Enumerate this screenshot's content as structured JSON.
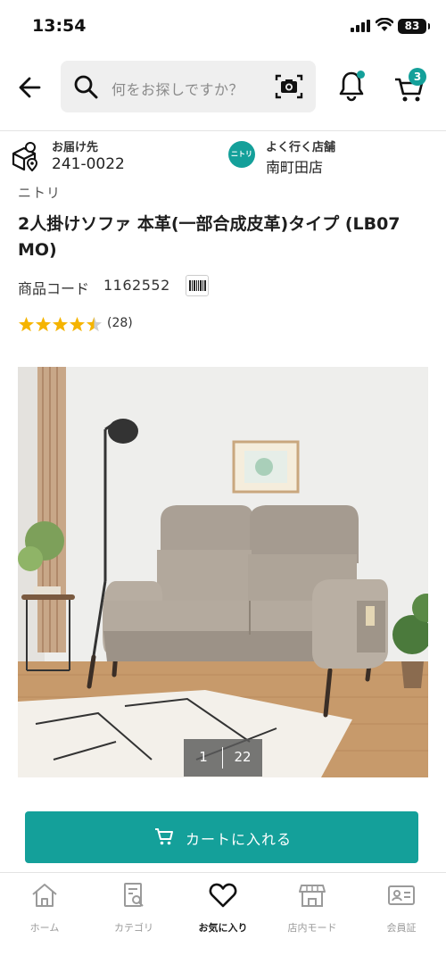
{
  "status_bar": {
    "time": "13:54",
    "battery": "83"
  },
  "header": {
    "search_placeholder": "何をお探しですか？",
    "notification_dot": true,
    "cart_count": "3"
  },
  "delivery": {
    "label": "お届け先",
    "postal_code": "241-0022"
  },
  "store": {
    "logo_text": "ニトリ",
    "label": "よく行く店舗",
    "name": "南町田店"
  },
  "product": {
    "brand": "ニトリ",
    "title": "2人掛けソファ 本革(一部合成皮革)タイプ (LB07 MO)",
    "code_label": "商品コード",
    "code": "1162552",
    "rating": 4.5,
    "review_count": "(28)"
  },
  "gallery": {
    "current": "1",
    "total": "22"
  },
  "actions": {
    "add_to_cart": "カートに入れる"
  },
  "bottom_nav": [
    {
      "label": "ホーム",
      "icon": "home-icon",
      "active": false
    },
    {
      "label": "カテゴリ",
      "icon": "category-icon",
      "active": false
    },
    {
      "label": "お気に入り",
      "icon": "heart-icon",
      "active": true
    },
    {
      "label": "店内モード",
      "icon": "store-mode-icon",
      "active": false
    },
    {
      "label": "会員証",
      "icon": "member-card-icon",
      "active": false
    }
  ],
  "colors": {
    "accent": "#14a09a",
    "star": "#f5b400",
    "star_empty": "#cfcfcf"
  }
}
